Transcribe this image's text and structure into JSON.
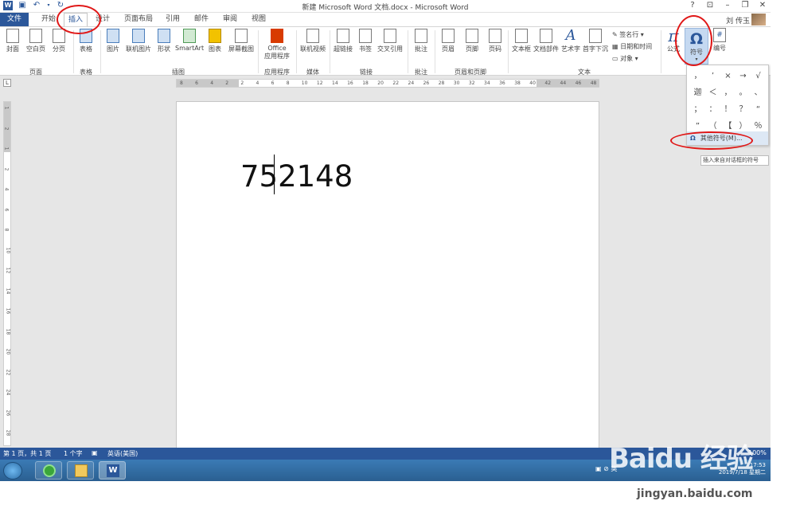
{
  "window": {
    "title": "新建 Microsoft Word 文档.docx - Microsoft Word",
    "help": "?",
    "user": "刘 传玉"
  },
  "tabs": [
    "文件",
    "开始",
    "插入",
    "设计",
    "页面布局",
    "引用",
    "邮件",
    "审阅",
    "视图"
  ],
  "ribbon": {
    "pages": {
      "cover": "封面",
      "blank": "空白页",
      "break": "分页",
      "label": "页面"
    },
    "tables": {
      "table": "表格",
      "label": "表格"
    },
    "illustrations": {
      "picture": "图片",
      "online_picture": "联机图片",
      "shapes": "形状",
      "smartart": "SmartArt",
      "chart": "图表",
      "screenshot": "屏幕截图",
      "label": "插图"
    },
    "apps": {
      "office_line1": "Office",
      "office_line2": "应用程序",
      "label": "应用程序"
    },
    "media": {
      "video": "联机视频",
      "label": "媒体"
    },
    "links": {
      "hyperlink": "超链接",
      "bookmark": "书签",
      "crossref": "交叉引用",
      "label": "链接"
    },
    "comments": {
      "comment": "批注",
      "label": "批注"
    },
    "header_footer": {
      "header": "页眉",
      "footer": "页脚",
      "page_number": "页码",
      "label": "页眉和页脚"
    },
    "text": {
      "textbox": "文本框",
      "quickparts": "文档部件",
      "wordart": "艺术字",
      "dropcap": "首字下沉",
      "signature": "签名行",
      "datetime": "日期和时间",
      "object": "对象",
      "label": "文本"
    },
    "symbols": {
      "equation": "公式",
      "symbol": "符号",
      "number": "编号"
    }
  },
  "ruler": {
    "h_ticks": [
      "8",
      "6",
      "4",
      "2",
      "2",
      "4",
      "6",
      "8",
      "10",
      "12",
      "14",
      "16",
      "18",
      "20",
      "22",
      "24",
      "26",
      "28",
      "30",
      "32",
      "34",
      "36",
      "38",
      "40",
      "42",
      "44",
      "46",
      "48"
    ],
    "v_ticks": [
      "1",
      "2",
      "1",
      "2",
      "4",
      "6",
      "8",
      "10",
      "12",
      "14",
      "16",
      "18",
      "20",
      "22",
      "24",
      "26",
      "28"
    ]
  },
  "document": {
    "text": "752148"
  },
  "symbol_dropdown": {
    "symbols": [
      "，",
      "’",
      "×",
      "→",
      "√",
      "迦",
      "＜",
      "，",
      "。",
      "、",
      "；",
      "：",
      "！",
      "？",
      "“",
      "”",
      "（",
      "【",
      "）",
      "％"
    ],
    "more_label": "其他符号(M)...",
    "more_icon": "Ω",
    "tooltip": "插入来自对话框的符号"
  },
  "statusbar": {
    "page": "第 1 页，共 1 页",
    "words": "1 个字",
    "lang": "英语(美国)",
    "zoom": "100%"
  },
  "taskbar": {
    "time": "17:53",
    "date": "2019/7/18 星期二",
    "ime": "英"
  },
  "watermark": {
    "brand": "Baidu 经验",
    "url": "jingyan.baidu.com"
  },
  "colors": {
    "word_blue": "#2b579a",
    "annotation_red": "#e01818"
  }
}
